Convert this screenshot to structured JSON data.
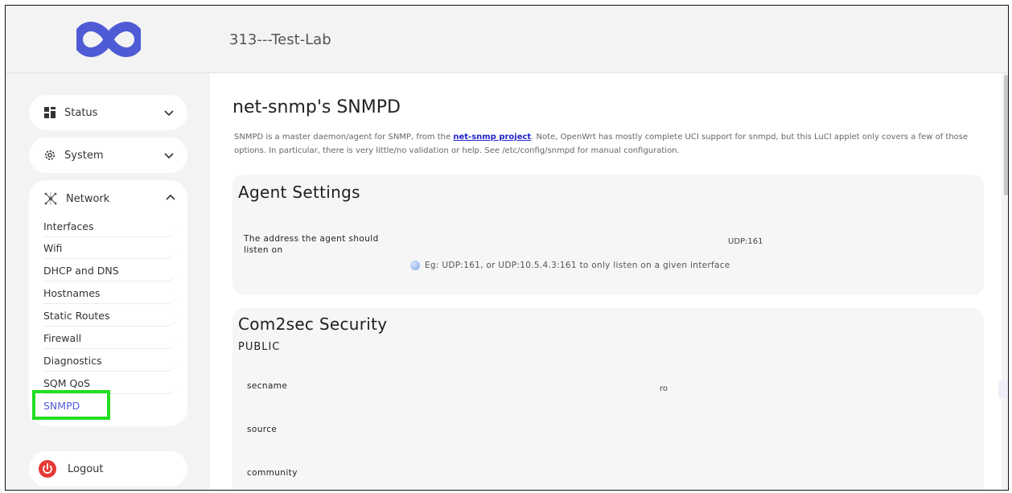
{
  "header": {
    "title": "313---Test-Lab"
  },
  "sidebar": {
    "status_label": "Status",
    "system_label": "System",
    "network_label": "Network",
    "network_items": [
      {
        "label": "Interfaces"
      },
      {
        "label": "Wifi"
      },
      {
        "label": "DHCP and DNS"
      },
      {
        "label": "Hostnames"
      },
      {
        "label": "Static Routes"
      },
      {
        "label": "Firewall"
      },
      {
        "label": "Diagnostics"
      },
      {
        "label": "SQM QoS"
      },
      {
        "label": "SNMPD"
      }
    ],
    "logout_label": "Logout"
  },
  "main": {
    "title": "net-snmp's SNMPD",
    "desc_before": "SNMPD is a master daemon/agent for SNMP, from the ",
    "desc_link": "net-snmp project",
    "desc_after": ". Note, OpenWrt has mostly complete UCI support for snmpd, but this LuCI applet only covers a few of those options. In particular, there is very little/no validation or help. See /etc/config/snmpd for manual configuration.",
    "agent": {
      "title": "Agent Settings",
      "listen_label": "The address the agent should listen on",
      "listen_value": "UDP:161",
      "listen_hint": "Eg: UDP:161, or UDP:10.5.4.3:161 to only listen on a given interface"
    },
    "com2sec": {
      "title": "Com2sec Security",
      "subtitle": "PUBLIC",
      "secname_label": "secname",
      "secname_value": "ro",
      "source_label": "source",
      "community_label": "community"
    }
  },
  "colors": {
    "accent": "#4f5bd5",
    "highlight": "#22dd22",
    "logout_red": "#e53935"
  }
}
